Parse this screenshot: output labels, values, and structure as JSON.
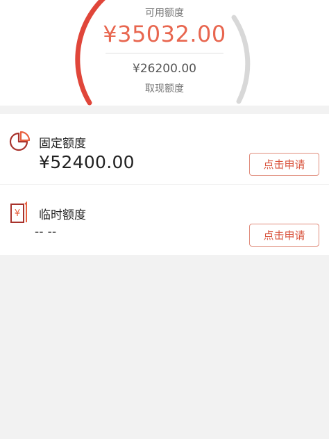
{
  "credit_gauge": {
    "available_label": "可用额度",
    "available_amount": "¥35032.00",
    "cash_amount": "¥26200.00",
    "cash_label": "取现额度",
    "colors": {
      "used_arc": "#e0463a",
      "remaining_arc": "#d8d8d8",
      "amount": "#e8664f"
    }
  },
  "fixed_limit": {
    "icon": "pie-chart-icon",
    "title": "固定额度",
    "amount": "¥52400.00",
    "button_label": "点击申请"
  },
  "temporary_limit": {
    "icon": "yuan-document-icon",
    "title": "临时额度",
    "amount": "-- --",
    "button_label": "点击申请"
  },
  "colors": {
    "accent": "#d9553f",
    "background": "#f2f2f2"
  }
}
